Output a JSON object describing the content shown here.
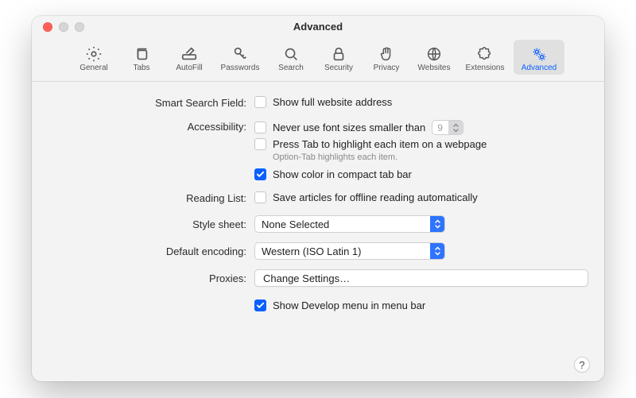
{
  "window": {
    "title": "Advanced"
  },
  "toolbar": {
    "items": [
      {
        "label": "General"
      },
      {
        "label": "Tabs"
      },
      {
        "label": "AutoFill"
      },
      {
        "label": "Passwords"
      },
      {
        "label": "Search"
      },
      {
        "label": "Security"
      },
      {
        "label": "Privacy"
      },
      {
        "label": "Websites"
      },
      {
        "label": "Extensions"
      },
      {
        "label": "Advanced"
      }
    ]
  },
  "sections": {
    "smartSearch": {
      "label": "Smart Search Field:",
      "showFullAddress": {
        "text": "Show full website address",
        "checked": false
      }
    },
    "accessibility": {
      "label": "Accessibility:",
      "minFont": {
        "text": "Never use font sizes smaller than",
        "checked": false,
        "value": "9"
      },
      "pressTab": {
        "text": "Press Tab to highlight each item on a webpage",
        "checked": false
      },
      "hint": "Option-Tab highlights each item.",
      "compactColor": {
        "text": "Show color in compact tab bar",
        "checked": true
      }
    },
    "readingList": {
      "label": "Reading List:",
      "saveOffline": {
        "text": "Save articles for offline reading automatically",
        "checked": false
      }
    },
    "styleSheet": {
      "label": "Style sheet:",
      "value": "None Selected"
    },
    "defaultEncoding": {
      "label": "Default encoding:",
      "value": "Western (ISO Latin 1)"
    },
    "proxies": {
      "label": "Proxies:",
      "button": "Change Settings…"
    },
    "develop": {
      "text": "Show Develop menu in menu bar",
      "checked": true
    }
  },
  "help": "?"
}
